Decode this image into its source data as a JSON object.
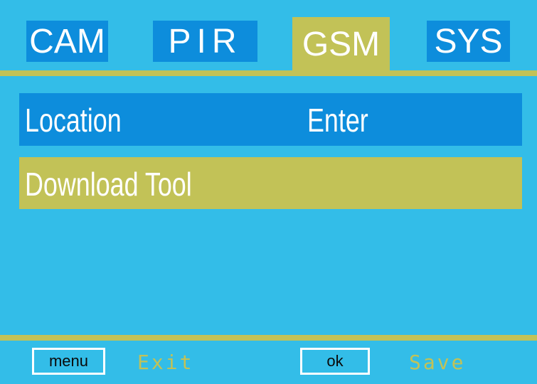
{
  "tabs": [
    {
      "label": "CAM",
      "state": "inactive"
    },
    {
      "label": "PIR",
      "state": "inactive"
    },
    {
      "label": "GSM",
      "state": "active"
    },
    {
      "label": "SYS",
      "state": "inactive"
    }
  ],
  "menu": {
    "items": [
      {
        "label": "Location",
        "value": "Enter",
        "state": "highlighted"
      },
      {
        "label": "Download Tool",
        "value": "",
        "state": "selected"
      }
    ]
  },
  "footer": {
    "menu_key": "menu",
    "menu_hint": "Exit",
    "ok_key": "ok",
    "ok_hint": "Save"
  },
  "colors": {
    "background": "#33bde8",
    "tab_blue": "#0d8ddc",
    "accent_olive": "#c2c257",
    "text_white": "#ffffff"
  }
}
